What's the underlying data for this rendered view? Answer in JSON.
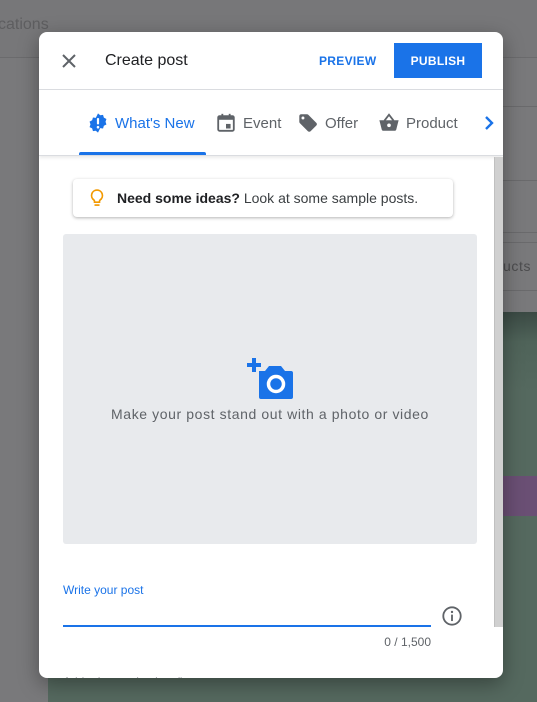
{
  "background": {
    "page_title_fragment": "cations",
    "side_label_fragment": "ucts"
  },
  "dialog": {
    "title": "Create post",
    "preview_label": "PREVIEW",
    "publish_label": "PUBLISH",
    "tabs": [
      {
        "label": "What's New",
        "icon": "whats-new-icon",
        "active": true
      },
      {
        "label": "Event",
        "icon": "calendar-icon",
        "active": false
      },
      {
        "label": "Offer",
        "icon": "tag-icon",
        "active": false
      },
      {
        "label": "Product",
        "icon": "shopping-basket-icon",
        "active": false
      }
    ],
    "ideas": {
      "bold": "Need some ideas?",
      "text": " Look at some sample posts."
    },
    "media": {
      "text": "Make your post stand out with a photo or video"
    },
    "post": {
      "label": "Write your post",
      "value": "",
      "counter": "0 / 1,500"
    },
    "cutoff_text": "Add a button (optional)"
  },
  "colors": {
    "accent": "#1a73e8",
    "bulb": "#f29900",
    "media_bg": "#e8eaed"
  }
}
